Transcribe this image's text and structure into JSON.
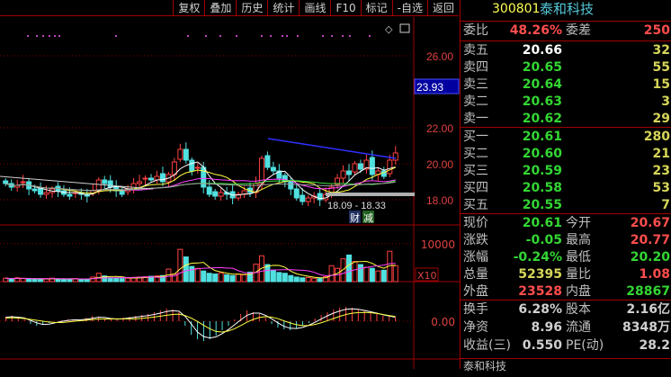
{
  "toolbar": [
    "复权",
    "叠加",
    "历史",
    "统计",
    "画线",
    "F10",
    "标记",
    "-自选",
    "返回"
  ],
  "axis": {
    "price": [
      "26.00",
      "22.00",
      "20.00",
      "18.00"
    ],
    "current_price_tag": "23.93",
    "volume": "10000",
    "volume_unit": "X10",
    "macd": "0.00"
  },
  "annotation": {
    "range": "18.09 - 18.33",
    "tag_cai": "财",
    "tag_jian": "减"
  },
  "stock": {
    "code": "300801",
    "name": "泰和科技"
  },
  "weibi": {
    "label": "委比",
    "value": "48.26%",
    "label2": "委差",
    "value2": "250"
  },
  "sells": [
    {
      "label": "卖五",
      "price": "20.66",
      "vol": "32"
    },
    {
      "label": "卖四",
      "price": "20.65",
      "vol": "55"
    },
    {
      "label": "卖三",
      "price": "20.64",
      "vol": "15"
    },
    {
      "label": "卖二",
      "price": "20.63",
      "vol": "3"
    },
    {
      "label": "卖一",
      "price": "20.62",
      "vol": "29"
    }
  ],
  "buys": [
    {
      "label": "买一",
      "price": "20.61",
      "vol": "280"
    },
    {
      "label": "买二",
      "price": "20.60",
      "vol": "21"
    },
    {
      "label": "买三",
      "price": "20.59",
      "vol": "23"
    },
    {
      "label": "买四",
      "price": "20.58",
      "vol": "53"
    },
    {
      "label": "买五",
      "price": "20.55",
      "vol": "7"
    }
  ],
  "stats": [
    {
      "l1": "现价",
      "v1": "20.61",
      "l2": "今开",
      "v2": "20.67"
    },
    {
      "l1": "涨跌",
      "v1": "-0.05",
      "l2": "最高",
      "v2": "20.77"
    },
    {
      "l1": "涨幅",
      "v1": "-0.24%",
      "l2": "最低",
      "v2": "20.20"
    },
    {
      "l1": "总量",
      "v1": "52395",
      "l2": "量比",
      "v2": "1.08"
    },
    {
      "l1": "外盘",
      "v1": "23528",
      "l2": "内盘",
      "v2": "28867"
    }
  ],
  "fundamentals": [
    {
      "l1": "换手",
      "v1": "6.28%",
      "l2": "股本",
      "v2": "2.16亿"
    },
    {
      "l1": "净资",
      "v1": "8.96",
      "l2": "流通",
      "v2": "8348万"
    },
    {
      "l1": "收益(三)",
      "v1": "0.550",
      "l2": "PE(动)",
      "v2": "28.2"
    }
  ],
  "footer": "泰和科技",
  "chart_data": {
    "type": "candlestick",
    "closes": [
      18.9,
      18.7,
      18.8,
      19.0,
      18.6,
      18.5,
      18.3,
      18.4,
      18.6,
      18.5,
      18.3,
      18.2,
      18.4,
      18.3,
      18.2,
      18.5,
      19.1,
      18.9,
      18.7,
      18.5,
      18.3,
      18.6,
      18.9,
      19.0,
      19.2,
      19.1,
      19.3,
      19.0,
      19.4,
      20.1,
      20.8,
      20.2,
      19.6,
      19.8,
      18.7,
      18.3,
      18.2,
      18.4,
      18.3,
      18.1,
      18.3,
      18.5,
      18.4,
      18.9,
      20.3,
      19.8,
      19.6,
      19.2,
      19.0,
      18.6,
      18.1,
      17.9,
      18.1,
      18.2,
      18.0,
      18.3,
      18.7,
      19.2,
      19.6,
      19.4,
      20.0,
      19.7,
      20.2,
      19.4,
      19.6,
      19.3,
      20.2,
      20.6
    ],
    "volumes": [
      900,
      700,
      1000,
      800,
      700,
      600,
      700,
      800,
      900,
      700,
      600,
      700,
      800,
      600,
      700,
      1200,
      2200,
      1500,
      1000,
      900,
      800,
      900,
      1100,
      1200,
      1300,
      1400,
      1500,
      1600,
      3300,
      2000,
      8500,
      6500,
      4000,
      3500,
      2800,
      2200,
      2000,
      2300,
      1800,
      1600,
      2000,
      1800,
      2500,
      4600,
      6800,
      4500,
      3000,
      2400,
      2200,
      1600,
      1200,
      1000,
      1100,
      900,
      800,
      1300,
      4200,
      3500,
      6000,
      7000,
      5300,
      4500,
      3800,
      3500,
      2800,
      3000,
      8000,
      4200
    ],
    "macd_hist": [
      0.05,
      0.06,
      0.04,
      0.02,
      -0.03,
      -0.05,
      -0.04,
      -0.02,
      0,
      0.01,
      0.02,
      0.02,
      0.01,
      0.04,
      0.06,
      0.05,
      0.03,
      0.02,
      0.03,
      0.04,
      0.05,
      0.06,
      0.07,
      0.08,
      0.1,
      0.12,
      0.14,
      0.13,
      0.1,
      -0.05,
      -0.15,
      -0.2,
      -0.22,
      -0.2,
      -0.16,
      -0.1,
      -0.05,
      0.02,
      0.08,
      0.12,
      0.1,
      0.08,
      0.04,
      -0.03,
      -0.07,
      -0.09,
      -0.1,
      -0.08,
      -0.05,
      -0.02,
      0.03,
      0.07,
      0.1,
      0.13,
      0.15,
      0.16,
      0.15,
      0.13,
      0.12,
      0.1,
      0.08,
      0.06,
      0.05,
      0.04
    ]
  }
}
